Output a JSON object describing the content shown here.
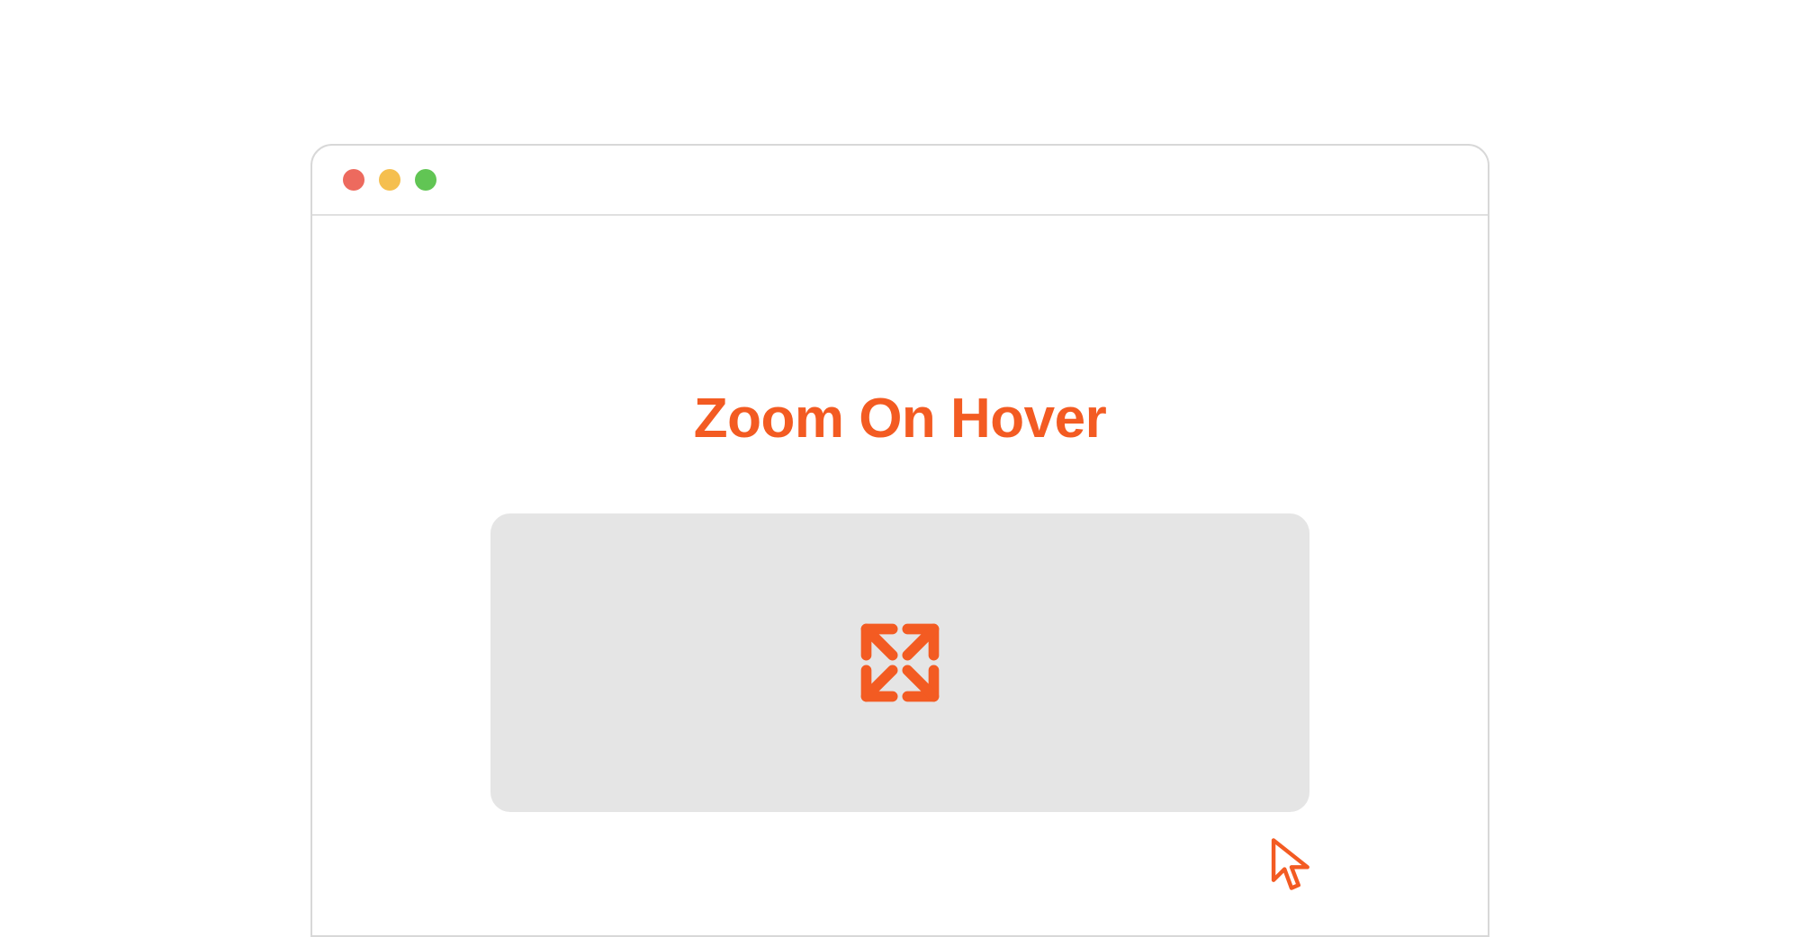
{
  "heading": "Zoom On Hover",
  "colors": {
    "accent": "#f35b22",
    "box_bg": "#e5e5e5",
    "window_border": "#d8d8d8"
  },
  "traffic_lights": {
    "red": "#ed6a5e",
    "yellow": "#f5bf4f",
    "green": "#61c554"
  },
  "icons": {
    "expand": "expand-icon",
    "cursor": "cursor-icon"
  }
}
